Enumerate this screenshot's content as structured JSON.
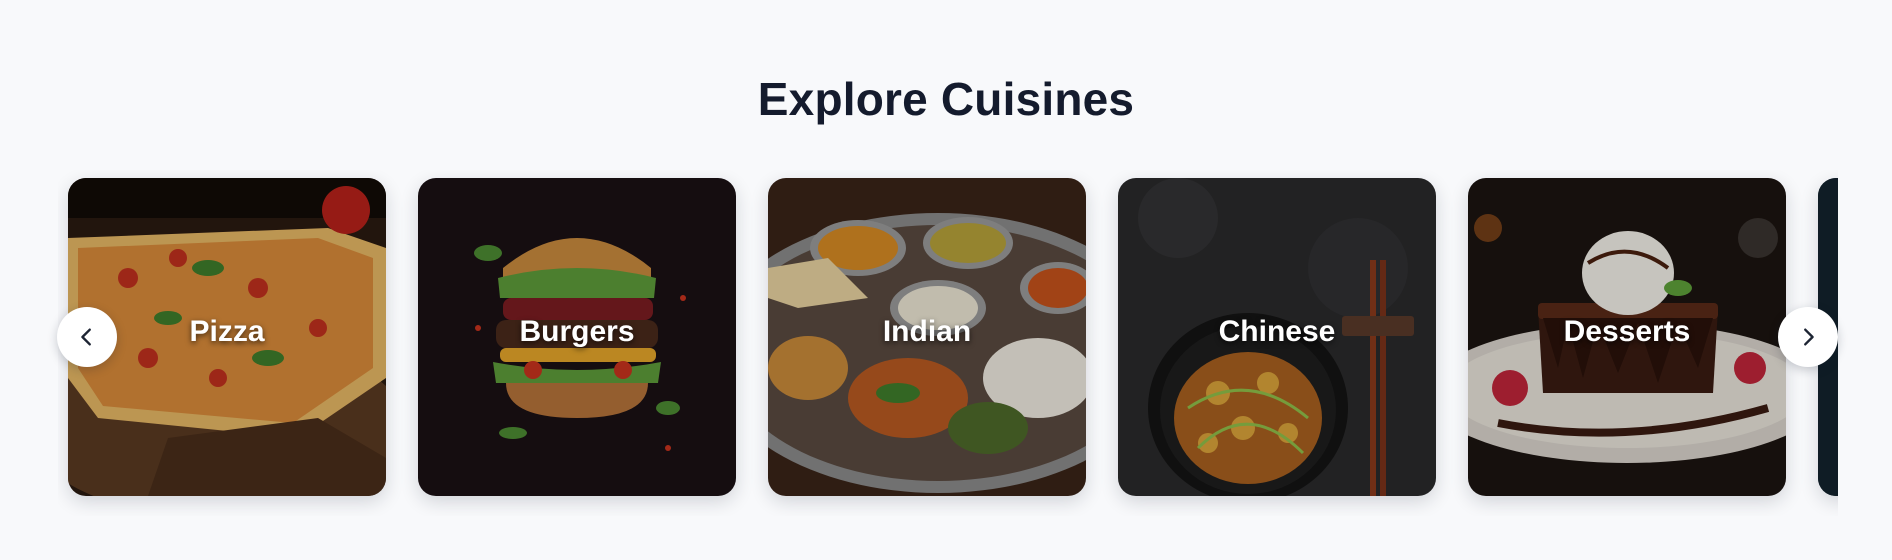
{
  "section": {
    "title": "Explore Cuisines"
  },
  "carousel": {
    "prev_icon": "chevron-left-icon",
    "next_icon": "chevron-right-icon",
    "cards": [
      {
        "label": "Pizza"
      },
      {
        "label": "Burgers"
      },
      {
        "label": "Indian"
      },
      {
        "label": "Chinese"
      },
      {
        "label": "Desserts"
      },
      {
        "label": ""
      }
    ]
  },
  "colors": {
    "background": "#f8f9fb",
    "title": "#141b2d",
    "card_label": "#ffffff",
    "nav_button": "#ffffff"
  }
}
